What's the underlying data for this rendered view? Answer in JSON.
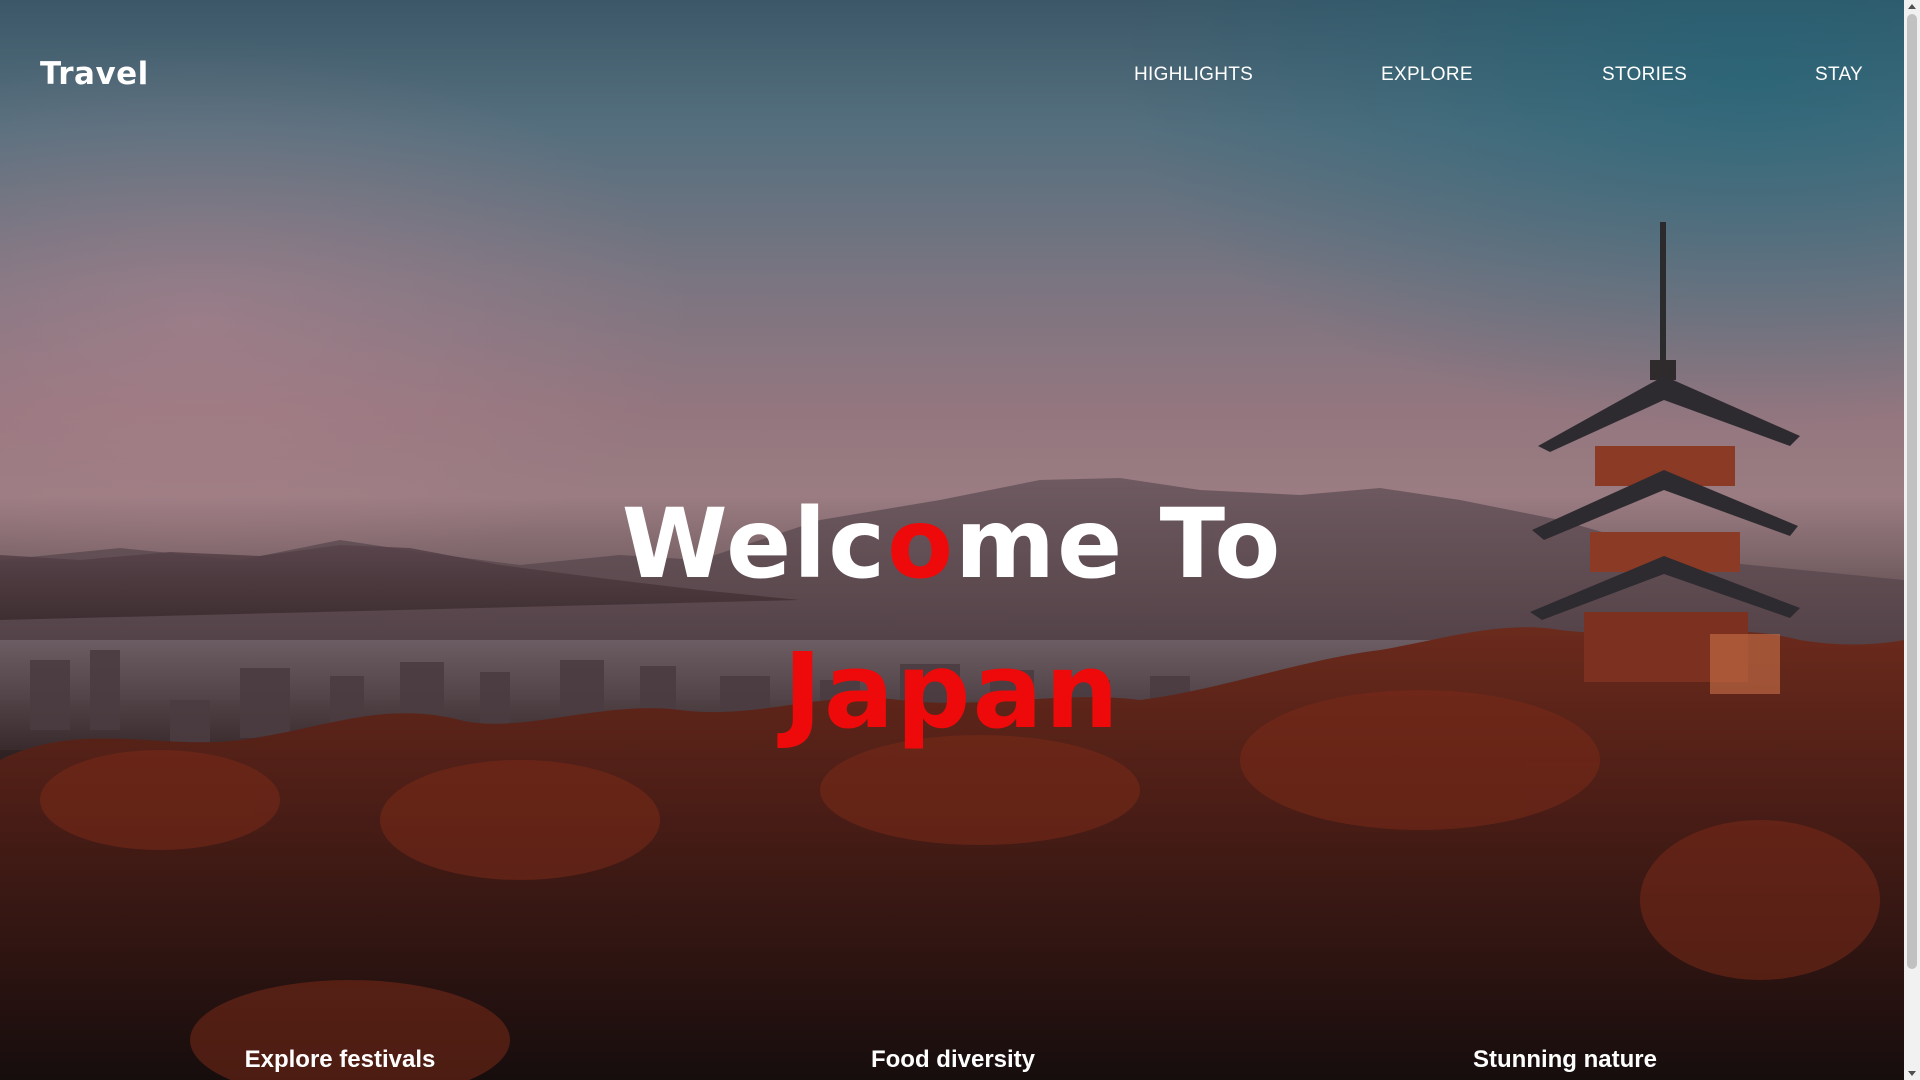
{
  "brand": {
    "logo": "Travel"
  },
  "nav": {
    "items": [
      {
        "label": "HIGHLIGHTS"
      },
      {
        "label": "EXPLORE"
      },
      {
        "label": "STORIES"
      },
      {
        "label": "STAY"
      }
    ]
  },
  "hero": {
    "line1_part1": "Welc",
    "line1_accent": "o",
    "line1_part2": "me To",
    "line2": "Japan",
    "accent_color": "#ee0a0a"
  },
  "features": [
    {
      "title": "Explore festivals"
    },
    {
      "title": "Food diversity"
    },
    {
      "title": "Stunning nature"
    }
  ]
}
